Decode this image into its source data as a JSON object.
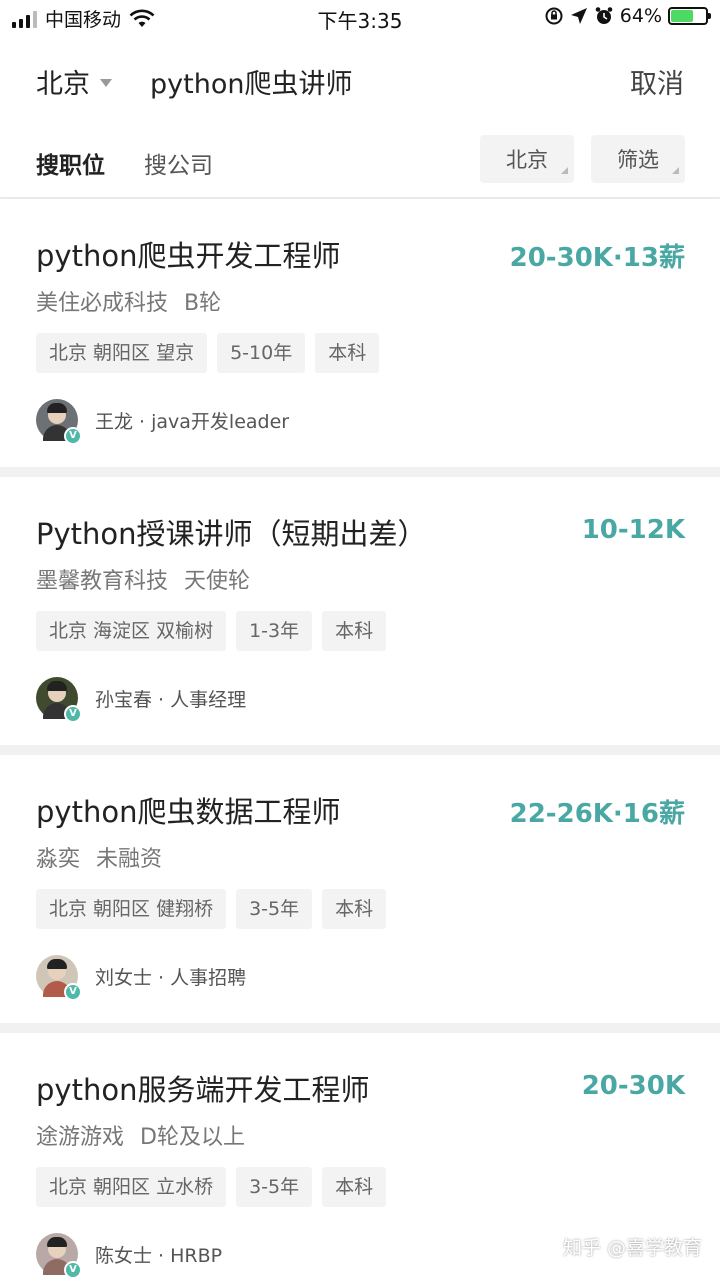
{
  "status_bar": {
    "carrier": "中国移动",
    "time": "下午3:35",
    "battery_percent": "64%",
    "battery_level": 0.64,
    "icons": [
      "signal-icon",
      "wifi-icon",
      "rotation-lock-icon",
      "location-icon",
      "alarm-icon",
      "battery-icon"
    ]
  },
  "search": {
    "city": "北京",
    "query": "python爬虫讲师",
    "cancel_label": "取消"
  },
  "tabs": {
    "jobs": "搜职位",
    "companies": "搜公司"
  },
  "filters": {
    "city": "北京",
    "filter": "筛选"
  },
  "jobs": [
    {
      "title": "python爬虫开发工程师",
      "salary": "20-30K·13薪",
      "company": "美住必成科技",
      "stage": "B轮",
      "tags": [
        "北京 朝阳区 望京",
        "5-10年",
        "本科"
      ],
      "recruiter": "王龙 · java开发leader"
    },
    {
      "title": "Python授课讲师（短期出差）",
      "salary": "10-12K",
      "company": "墨馨教育科技",
      "stage": "天使轮",
      "tags": [
        "北京 海淀区 双榆树",
        "1-3年",
        "本科"
      ],
      "recruiter": "孙宝春 · 人事经理"
    },
    {
      "title": "python爬虫数据工程师",
      "salary": "22-26K·16薪",
      "company": "淼奕",
      "stage": "未融资",
      "tags": [
        "北京 朝阳区 健翔桥",
        "3-5年",
        "本科"
      ],
      "recruiter": "刘女士 · 人事招聘"
    },
    {
      "title": "python服务端开发工程师",
      "salary": "20-30K",
      "company": "途游游戏",
      "stage": "D轮及以上",
      "tags": [
        "北京 朝阳区 立水桥",
        "3-5年",
        "本科"
      ],
      "recruiter": "陈女士 · HRBP"
    }
  ],
  "verified_mark": "V",
  "watermark": "知乎 @喜学教育",
  "colors": {
    "salary": "#4aa8a4",
    "verified": "#4fb8a8",
    "tag_bg": "#f3f3f3"
  }
}
